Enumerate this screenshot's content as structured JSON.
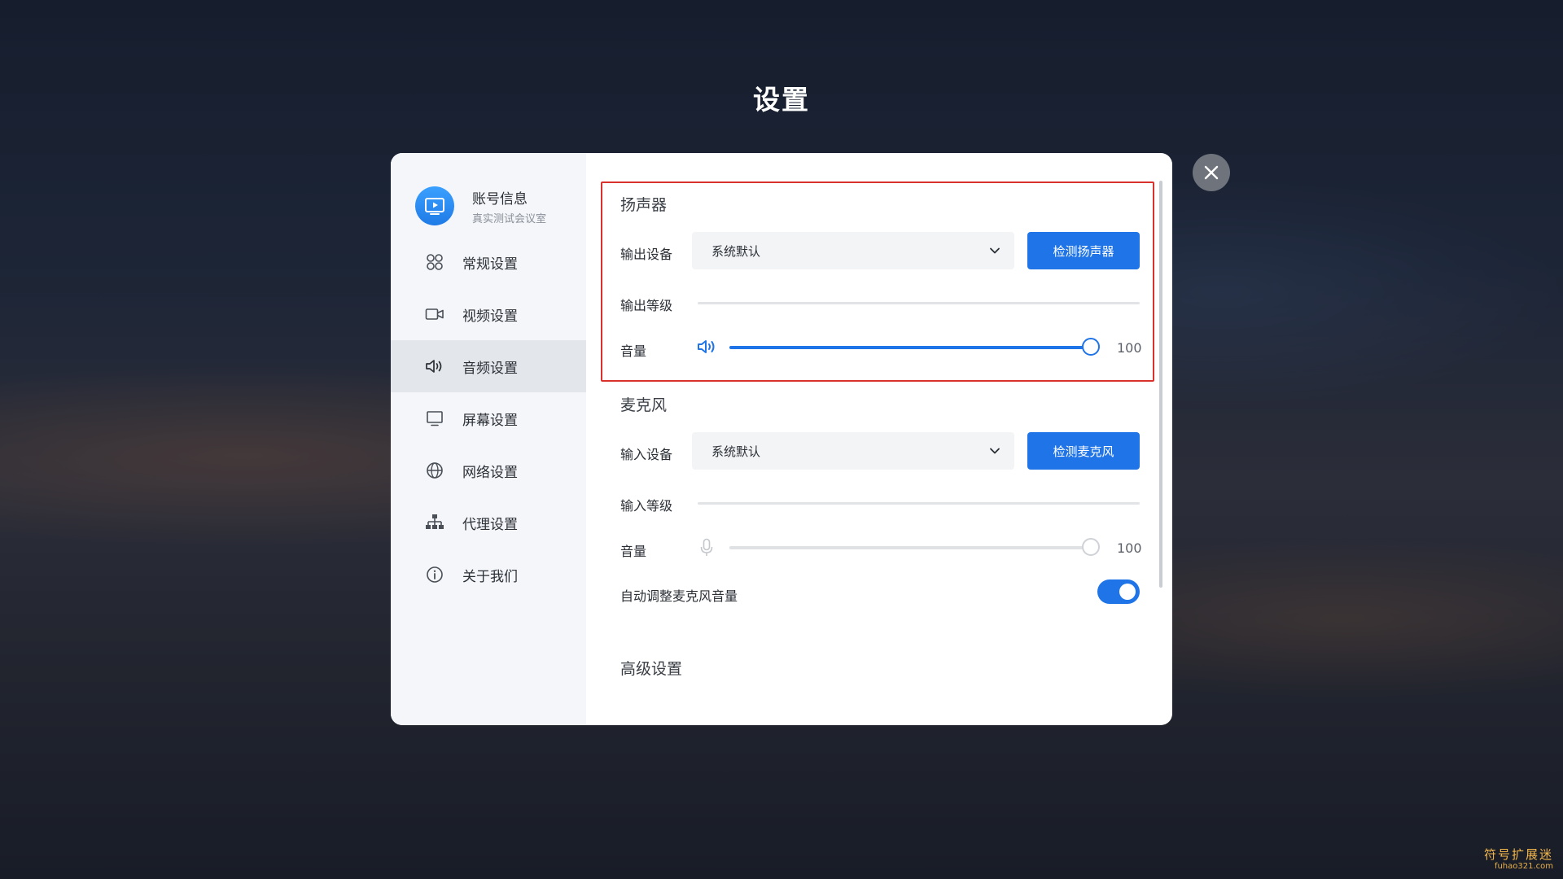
{
  "page": {
    "title": "设置"
  },
  "colors": {
    "accent": "#1f74e8",
    "highlight_border": "#d9322c",
    "slider_disabled": "#cfd2d7"
  },
  "icons": {
    "close": "close-icon",
    "avatar": "play-screen-icon"
  },
  "sidebar": {
    "account": {
      "name": "账号信息",
      "subtitle": "真实测试会议室"
    },
    "items": [
      {
        "label": "常规设置",
        "icon": "grid-circles-icon",
        "active": false
      },
      {
        "label": "视频设置",
        "icon": "video-camera-icon",
        "active": false
      },
      {
        "label": "音频设置",
        "icon": "speaker-icon",
        "active": true
      },
      {
        "label": "屏幕设置",
        "icon": "monitor-icon",
        "active": false
      },
      {
        "label": "网络设置",
        "icon": "globe-icon",
        "active": false
      },
      {
        "label": "代理设置",
        "icon": "network-tree-icon",
        "active": false
      },
      {
        "label": "关于我们",
        "icon": "info-icon",
        "active": false
      }
    ]
  },
  "speaker": {
    "title": "扬声器",
    "output_device_label": "输出设备",
    "output_device_value": "系统默认",
    "test_button": "检测扬声器",
    "output_level_label": "输出等级",
    "volume_label": "音量",
    "volume_value": "100",
    "volume_fraction": 1.0
  },
  "microphone": {
    "title": "麦克风",
    "input_device_label": "输入设备",
    "input_device_value": "系统默认",
    "test_button": "检测麦克风",
    "input_level_label": "输入等级",
    "volume_label": "音量",
    "volume_value": "100",
    "volume_fraction": 1.0,
    "auto_adjust_label": "自动调整麦克风音量",
    "auto_adjust_enabled": true
  },
  "advanced": {
    "title": "高级设置"
  },
  "watermark": {
    "main": "符号扩展迷",
    "sub": "fuhao321.com"
  }
}
